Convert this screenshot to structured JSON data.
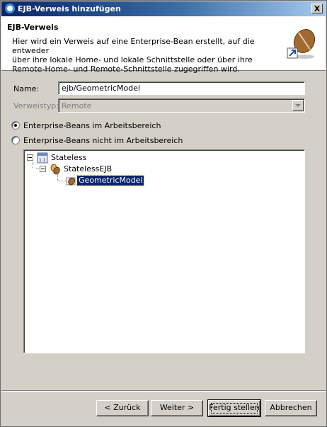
{
  "window": {
    "title": "EJB-Verweis hinzufügen",
    "close_symbol": "X"
  },
  "banner": {
    "title": "EJB-Verweis",
    "description": [
      "Hier wird ein Verweis auf eine Enterprise-Bean erstellt, auf die entweder",
      "über ihre lokale Home- und lokale Schnittstelle oder über ihre",
      "Remote-Home- und Remote-Schnittstelle zugegriffen wird."
    ]
  },
  "form": {
    "name_label": "Name:",
    "name_value": "ejb/GeometricModel",
    "type_label": "Verweistyp:",
    "type_value": "Remote"
  },
  "options": {
    "in_workspace": "Enterprise-Beans im Arbeitsbereich",
    "not_in_workspace": "Enterprise-Beans nicht im Arbeitsbereich",
    "selected": "in_workspace"
  },
  "tree": {
    "root": "Stateless",
    "child": "StatelessEJB",
    "leaf": "GeometricModel",
    "selected": "GeometricModel"
  },
  "buttons": {
    "back": "< Zurück",
    "next": "Weiter >",
    "finish": "Fertig stellen",
    "cancel": "Abbrechen"
  },
  "colors": {
    "title_start": "#0a246a",
    "title_end": "#a6caf0",
    "selection": "#0a246a",
    "dialog_bg": "#d4d0c8"
  }
}
